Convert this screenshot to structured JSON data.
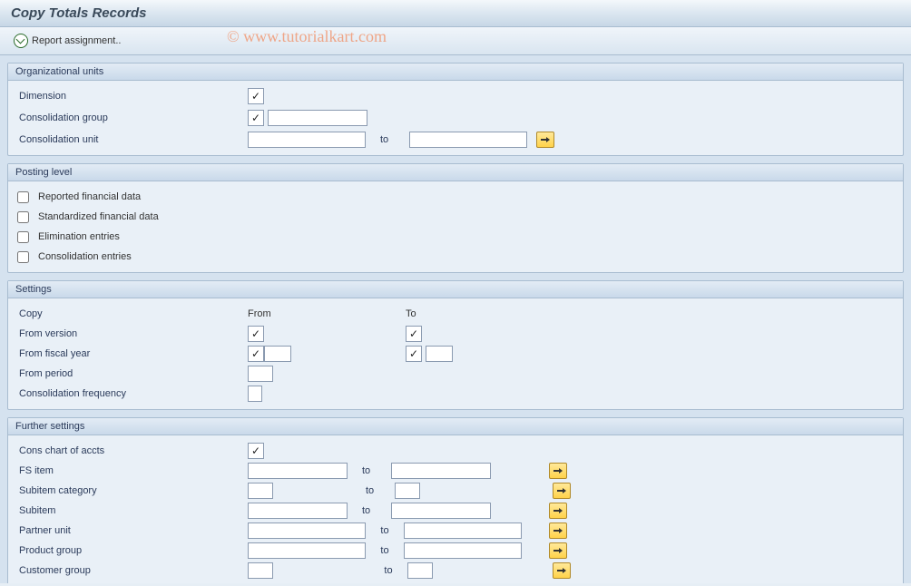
{
  "title": "Copy Totals Records",
  "toolbar": {
    "report_assignment": "Report assignment.."
  },
  "watermark": "© www.tutorialkart.com",
  "org_units": {
    "header": "Organizational units",
    "dimension_label": "Dimension",
    "cons_group_label": "Consolidation group",
    "cons_unit_label": "Consolidation unit",
    "to": "to"
  },
  "posting_level": {
    "header": "Posting level",
    "reported": "Reported financial data",
    "standardized": "Standardized financial data",
    "elimination": "Elimination entries",
    "consolidation": "Consolidation entries"
  },
  "settings": {
    "header": "Settings",
    "copy_label": "Copy",
    "from_hdr": "From",
    "to_hdr": "To",
    "from_version": "From version",
    "from_fiscal_year": "From fiscal year",
    "from_period": "From period",
    "cons_freq": "Consolidation frequency"
  },
  "further": {
    "header": "Further settings",
    "cons_chart": "Cons chart of accts",
    "fs_item": "FS item",
    "subitem_cat": "Subitem category",
    "subitem": "Subitem",
    "partner_unit": "Partner unit",
    "product_group": "Product group",
    "customer_group": "Customer group",
    "to": "to"
  }
}
